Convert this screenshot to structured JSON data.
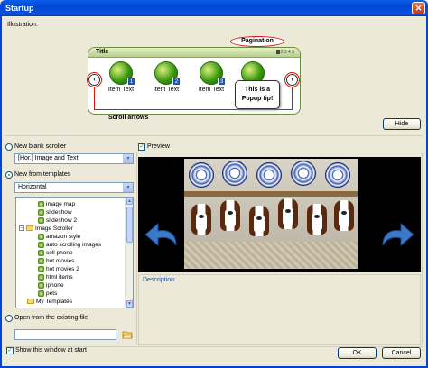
{
  "window": {
    "title": "Startup"
  },
  "illustration": {
    "label": "Illustration:",
    "scroller_title": "Title",
    "pagination_label": "Pagination",
    "pagination_numbers": "2 3 4 5",
    "items": [
      {
        "text": "Item Text",
        "badge": "1"
      },
      {
        "text": "Item Text",
        "badge": "2"
      },
      {
        "text": "Item Text",
        "badge": "3"
      }
    ],
    "popup_text_1": "This is a",
    "popup_text_2": "Popup tip!",
    "scroll_arrows_label": "Scroll arrows",
    "prev_arrow": "‹",
    "next_arrow": "›",
    "hide_button": "Hide"
  },
  "options": {
    "new_blank": {
      "label": "New blank scroller",
      "selected": false,
      "dropdown_value": "[Hor.] Image and Text"
    },
    "new_from_templates": {
      "label": "New from templates",
      "selected": true,
      "dropdown_value": "Horizontal"
    },
    "tree": [
      {
        "label": "image map",
        "level": 2,
        "type": "item"
      },
      {
        "label": "slideshow",
        "level": 2,
        "type": "item"
      },
      {
        "label": "slideshow 2",
        "level": 2,
        "type": "item"
      },
      {
        "label": "Image Scroller",
        "level": 1,
        "type": "folder"
      },
      {
        "label": "amazon style",
        "level": 2,
        "type": "item"
      },
      {
        "label": "auto scrolling images",
        "level": 2,
        "type": "item"
      },
      {
        "label": "cell phone",
        "level": 2,
        "type": "item"
      },
      {
        "label": "hot movies",
        "level": 2,
        "type": "item"
      },
      {
        "label": "hot movies 2",
        "level": 2,
        "type": "item"
      },
      {
        "label": "html items",
        "level": 2,
        "type": "item"
      },
      {
        "label": "iphone",
        "level": 2,
        "type": "item"
      },
      {
        "label": "pets",
        "level": 2,
        "type": "item"
      },
      {
        "label": "My Templates",
        "level": 1,
        "type": "folder"
      }
    ],
    "open_existing": {
      "label": "Open from the existing file",
      "selected": false,
      "path_value": ""
    }
  },
  "preview": {
    "label": "Preview",
    "checked": true,
    "description_label": "Description:"
  },
  "footer": {
    "show_at_start_label": "Show this window at start",
    "show_at_start_checked": true,
    "ok_button": "OK",
    "cancel_button": "Cancel"
  }
}
